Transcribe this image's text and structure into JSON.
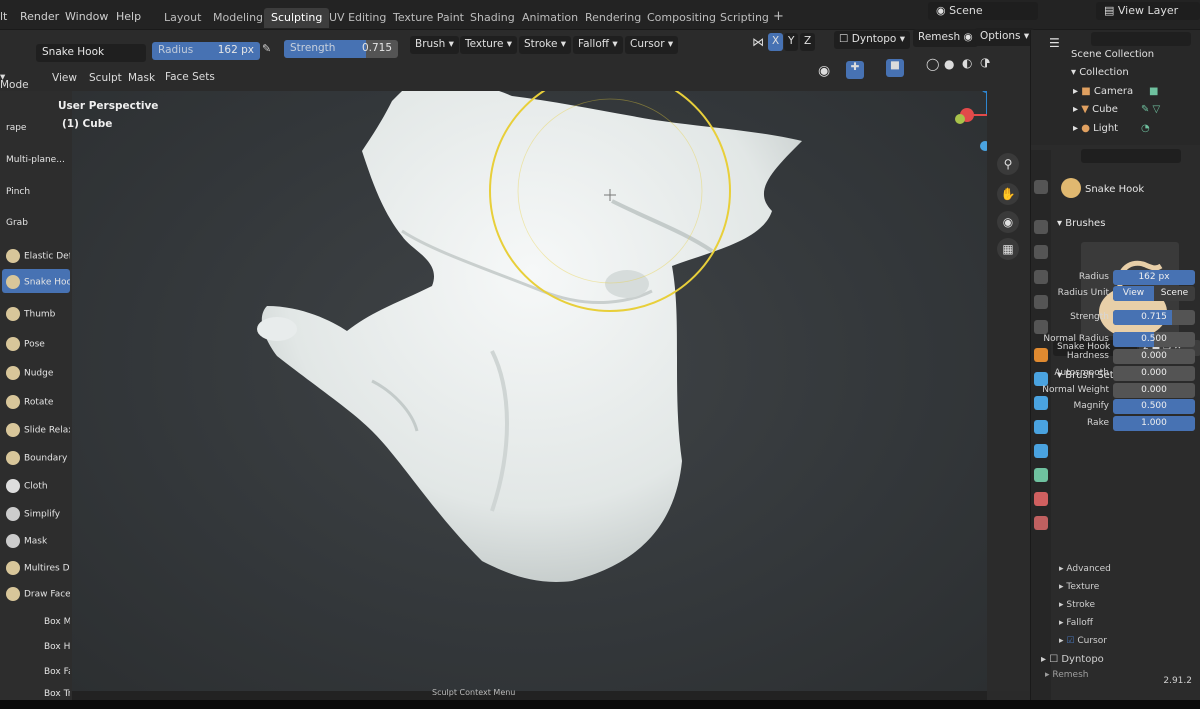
{
  "menu": {
    "items": [
      "lt",
      "Render",
      "Window",
      "Help"
    ]
  },
  "workspaces": {
    "tabs": [
      "Layout",
      "Modeling",
      "Sculpting",
      "UV Editing",
      "Texture Paint",
      "Shading",
      "Animation",
      "Rendering",
      "Compositing",
      "Scripting"
    ],
    "active": "Sculpting",
    "add": "+"
  },
  "scene": {
    "name": "Scene",
    "view_layer": "View Layer"
  },
  "tool_header": {
    "brush_name": "Snake Hook",
    "radius_label": "Radius",
    "radius_value": "162 px",
    "strength_label": "Strength",
    "strength_value": "0.715",
    "strength_fraction": 0.715,
    "menus": [
      "Brush",
      "Texture",
      "Stroke",
      "Falloff",
      "Cursor"
    ],
    "axes": [
      "X",
      "Y",
      "Z"
    ],
    "dyntopo": "Dyntopo",
    "remesh": "Remesh",
    "options": "Options"
  },
  "header2": {
    "mode": "Mode",
    "items": [
      "View",
      "Sculpt",
      "Mask",
      "Face Sets"
    ]
  },
  "viewport": {
    "perspective": "User Perspective",
    "object": "(1) Cube"
  },
  "tools": [
    {
      "label": "rape"
    },
    {
      "label": "Multi-plane..."
    },
    {
      "label": "Pinch"
    },
    {
      "label": "Grab"
    },
    {
      "label": "Elastic Def..."
    },
    {
      "label": "Snake Hook",
      "active": true
    },
    {
      "label": "Thumb"
    },
    {
      "label": "Pose"
    },
    {
      "label": "Nudge"
    },
    {
      "label": "Rotate"
    },
    {
      "label": "Slide Relax"
    },
    {
      "label": "Boundary"
    },
    {
      "label": "Cloth"
    },
    {
      "label": "Simplify"
    },
    {
      "label": "Mask"
    },
    {
      "label": "Multires Di..."
    },
    {
      "label": "Draw Face..."
    },
    {
      "label": "Box Mask"
    },
    {
      "label": "Box Hide"
    },
    {
      "label": "Box Face ..."
    },
    {
      "label": "Box Trim"
    }
  ],
  "outliner": {
    "root": "Scene Collection",
    "collection": "Collection",
    "items": [
      "Camera",
      "Cube",
      "Light"
    ]
  },
  "properties": {
    "brush_title": "Snake Hook",
    "brushes_panel": "Brushes",
    "brush_slot": "Snake Hook",
    "brush_users": "2",
    "settings_panel": "Brush Settings",
    "rows": [
      {
        "label": "Radius",
        "value": "162 px",
        "fill": 1
      },
      {
        "label": "Radius Unit",
        "value": "View",
        "alt": "Scene"
      },
      {
        "label": "Strength",
        "value": "0.715",
        "fill": 0.715
      },
      {
        "label": "Normal Radius",
        "value": "0.500",
        "fill": 0.5
      },
      {
        "label": "Hardness",
        "value": "0.000",
        "fill": 0
      },
      {
        "label": "Autosmooth",
        "value": "0.000",
        "fill": 0
      },
      {
        "label": "Normal Weight",
        "value": "0.000",
        "fill": 0
      },
      {
        "label": "Magnify",
        "value": "0.500",
        "fill": 1
      },
      {
        "label": "Rake",
        "value": "1.000",
        "fill": 1
      }
    ],
    "subpanels": [
      "Advanced",
      "Texture",
      "Stroke",
      "Falloff",
      "Cursor"
    ],
    "dyntopo": "Dyntopo",
    "remesh": "Remesh"
  },
  "status": {
    "context": "Sculpt Context Menu",
    "version": "2.91.2"
  },
  "colors": {
    "accent": "#4772b3",
    "brush_circle": "#e8cf3a",
    "mesh": "#e7eceb"
  }
}
